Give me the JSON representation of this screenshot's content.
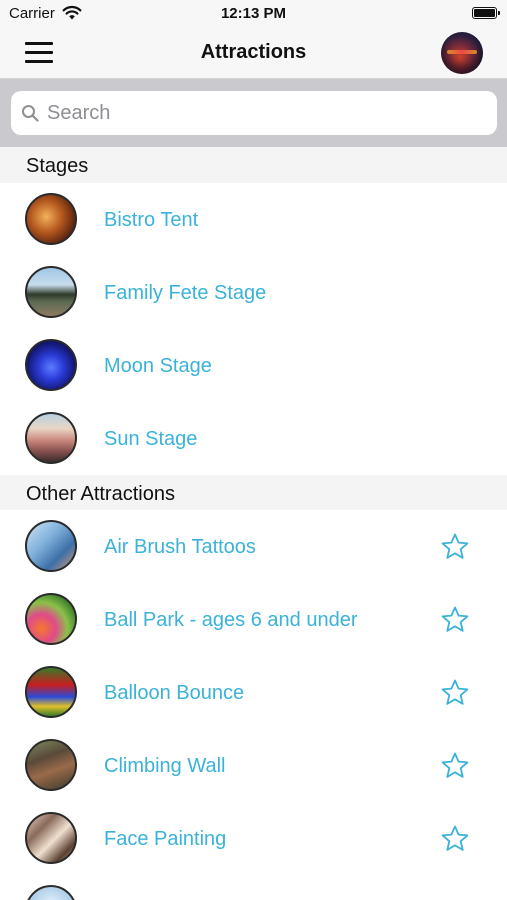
{
  "status_bar": {
    "carrier": "Carrier",
    "time": "12:13 PM"
  },
  "nav": {
    "title": "Attractions",
    "menu_icon": "hamburger-menu-icon",
    "profile_icon": "profile-avatar"
  },
  "search": {
    "placeholder": "Search",
    "value": ""
  },
  "sections": [
    {
      "header": "Stages",
      "items": [
        {
          "label": "Bistro Tent",
          "favoritable": false
        },
        {
          "label": "Family Fete Stage",
          "favoritable": false
        },
        {
          "label": "Moon Stage",
          "favoritable": false
        },
        {
          "label": "Sun Stage",
          "favoritable": false
        }
      ]
    },
    {
      "header": "Other Attractions",
      "items": [
        {
          "label": "Air Brush Tattoos",
          "favoritable": true
        },
        {
          "label": "Ball Park - ages 6 and under",
          "favoritable": true
        },
        {
          "label": "Balloon Bounce",
          "favoritable": true
        },
        {
          "label": "Climbing Wall",
          "favoritable": true
        },
        {
          "label": "Face Painting",
          "favoritable": true
        }
      ]
    }
  ],
  "colors": {
    "accent": "#3bb2d8",
    "section_bg": "#f4f4f4",
    "search_bar_bg": "#c9c9ce",
    "nav_bg": "#f7f7f7"
  },
  "icons": {
    "favorite": "star-outline-icon",
    "search": "search-icon",
    "wifi": "wifi-icon",
    "battery": "battery-icon"
  }
}
